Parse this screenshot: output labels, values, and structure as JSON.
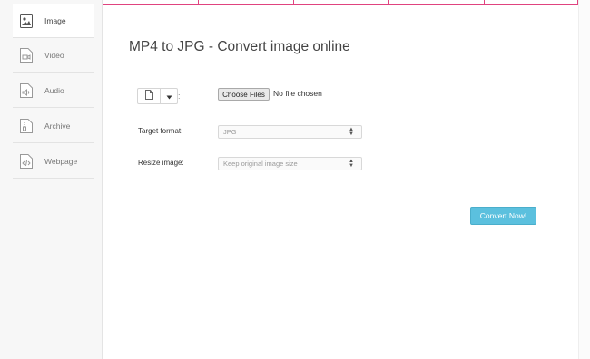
{
  "sidebar": {
    "items": [
      {
        "label": "Image",
        "icon": "image-icon",
        "active": true
      },
      {
        "label": "Video",
        "icon": "video-icon",
        "active": false
      },
      {
        "label": "Audio",
        "icon": "audio-icon",
        "active": false
      },
      {
        "label": "Archive",
        "icon": "archive-icon",
        "active": false
      },
      {
        "label": "Webpage",
        "icon": "webpage-icon",
        "active": false
      }
    ]
  },
  "main": {
    "title": "MP4 to JPG - Convert image online",
    "file": {
      "choose_label": "Choose Files",
      "status": "No file chosen",
      "separator": ":"
    },
    "target_format": {
      "label": "Target format:",
      "value": "JPG"
    },
    "resize": {
      "label": "Resize image:",
      "value": "Keep original image size"
    },
    "convert_label": "Convert Now!"
  },
  "colors": {
    "accent": "#e0437f",
    "button": "#5bc0de"
  }
}
